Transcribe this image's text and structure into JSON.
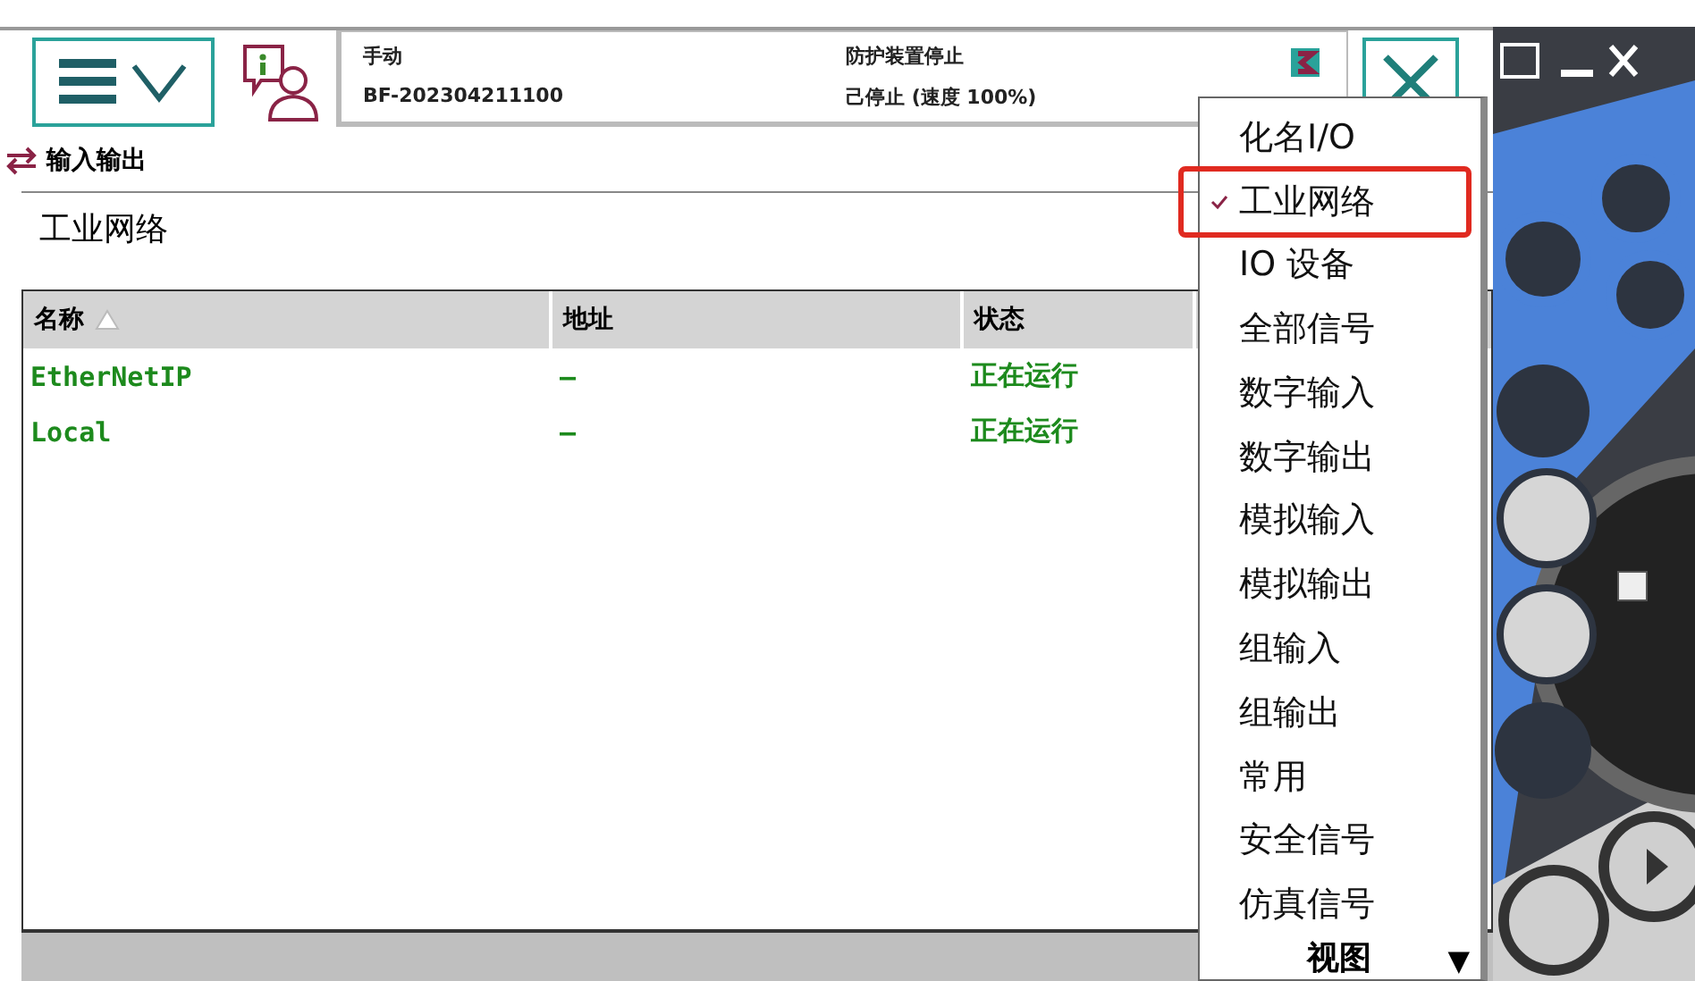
{
  "header": {
    "status_left": [
      "手动",
      "BF-202304211100"
    ],
    "status_right": [
      "防护装置停止",
      "己停止 (速度 100%)"
    ]
  },
  "app_title": "输入输出",
  "view_title": "工业网络",
  "table": {
    "columns": [
      {
        "label": "名称",
        "sorted": true
      },
      {
        "label": "地址",
        "sorted": false
      },
      {
        "label": "状态",
        "sorted": false
      }
    ],
    "rows": [
      {
        "cells": [
          "EtherNetIP",
          "–",
          "正在运行"
        ],
        "running": true
      },
      {
        "cells": [
          "Local",
          "–",
          "正在运行"
        ],
        "running": true
      }
    ]
  },
  "menu": {
    "items": [
      {
        "label": "化名I/O",
        "selected": false,
        "highlighted": false
      },
      {
        "label": "工业网络",
        "selected": true,
        "highlighted": true
      },
      {
        "label": "IO 设备",
        "selected": false,
        "highlighted": false
      },
      {
        "label": "全部信号",
        "selected": false,
        "highlighted": false
      },
      {
        "label": "数字输入",
        "selected": false,
        "highlighted": false
      },
      {
        "label": "数字输出",
        "selected": false,
        "highlighted": false
      },
      {
        "label": "模拟输入",
        "selected": false,
        "highlighted": false
      },
      {
        "label": "模拟输出",
        "selected": false,
        "highlighted": false
      },
      {
        "label": "组输入",
        "selected": false,
        "highlighted": false
      },
      {
        "label": "组输出",
        "selected": false,
        "highlighted": false
      },
      {
        "label": "常用",
        "selected": false,
        "highlighted": false
      },
      {
        "label": "安全信号",
        "selected": false,
        "highlighted": false
      },
      {
        "label": "仿真信号",
        "selected": false,
        "highlighted": false
      }
    ],
    "footer": "视图",
    "scroll_arrow": "▼"
  }
}
